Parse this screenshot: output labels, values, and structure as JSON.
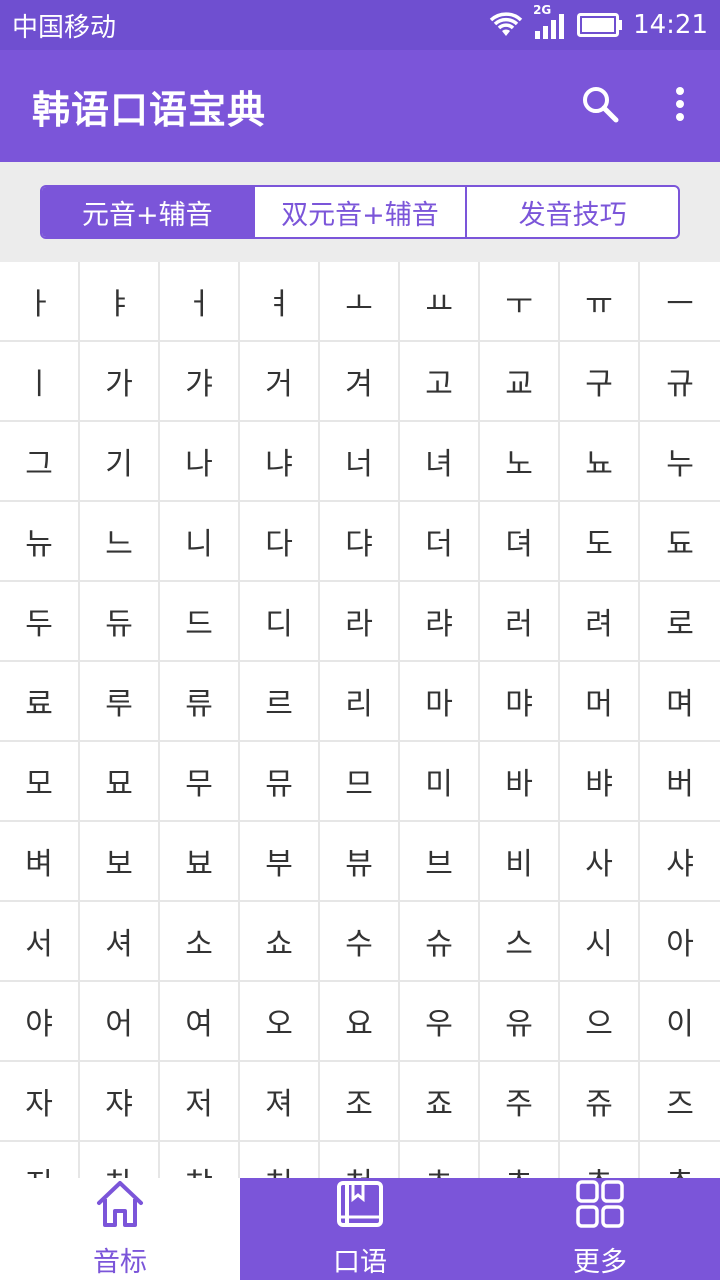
{
  "status_bar": {
    "carrier": "中国移动",
    "network": "2G",
    "time": "14:21"
  },
  "app_bar": {
    "title": "韩语口语宝典",
    "icons": [
      "search-icon",
      "more-vert-icon"
    ]
  },
  "segments": [
    {
      "label": "元音+辅音",
      "active": true
    },
    {
      "label": "双元音+辅音",
      "active": false
    },
    {
      "label": "发音技巧",
      "active": false
    }
  ],
  "syllables": [
    "ㅏ",
    "ㅑ",
    "ㅓ",
    "ㅕ",
    "ㅗ",
    "ㅛ",
    "ㅜ",
    "ㅠ",
    "ㅡ",
    "ㅣ",
    "가",
    "갸",
    "거",
    "겨",
    "고",
    "교",
    "구",
    "규",
    "그",
    "기",
    "나",
    "냐",
    "너",
    "녀",
    "노",
    "뇨",
    "누",
    "뉴",
    "느",
    "니",
    "다",
    "댜",
    "더",
    "뎌",
    "도",
    "됴",
    "두",
    "듀",
    "드",
    "디",
    "라",
    "랴",
    "러",
    "려",
    "로",
    "료",
    "루",
    "류",
    "르",
    "리",
    "마",
    "먀",
    "머",
    "며",
    "모",
    "묘",
    "무",
    "뮤",
    "므",
    "미",
    "바",
    "뱌",
    "버",
    "벼",
    "보",
    "뵤",
    "부",
    "뷰",
    "브",
    "비",
    "사",
    "샤",
    "서",
    "셔",
    "소",
    "쇼",
    "수",
    "슈",
    "스",
    "시",
    "아",
    "야",
    "어",
    "여",
    "오",
    "요",
    "우",
    "유",
    "으",
    "이",
    "자",
    "쟈",
    "저",
    "져",
    "조",
    "죠",
    "주",
    "쥬",
    "즈",
    "지",
    "차",
    "챠",
    "처",
    "쳐",
    "초",
    "쵸",
    "추",
    "츄"
  ],
  "bottom_tabs": [
    {
      "label": "音标",
      "icon": "home-icon",
      "active": true
    },
    {
      "label": "口语",
      "icon": "book-icon",
      "active": false
    },
    {
      "label": "更多",
      "icon": "grid-icon",
      "active": false
    }
  ],
  "colors": {
    "primary": "#7b55d9",
    "status_bar": "#6f4fd0",
    "grid_line": "#e6e6e6"
  }
}
